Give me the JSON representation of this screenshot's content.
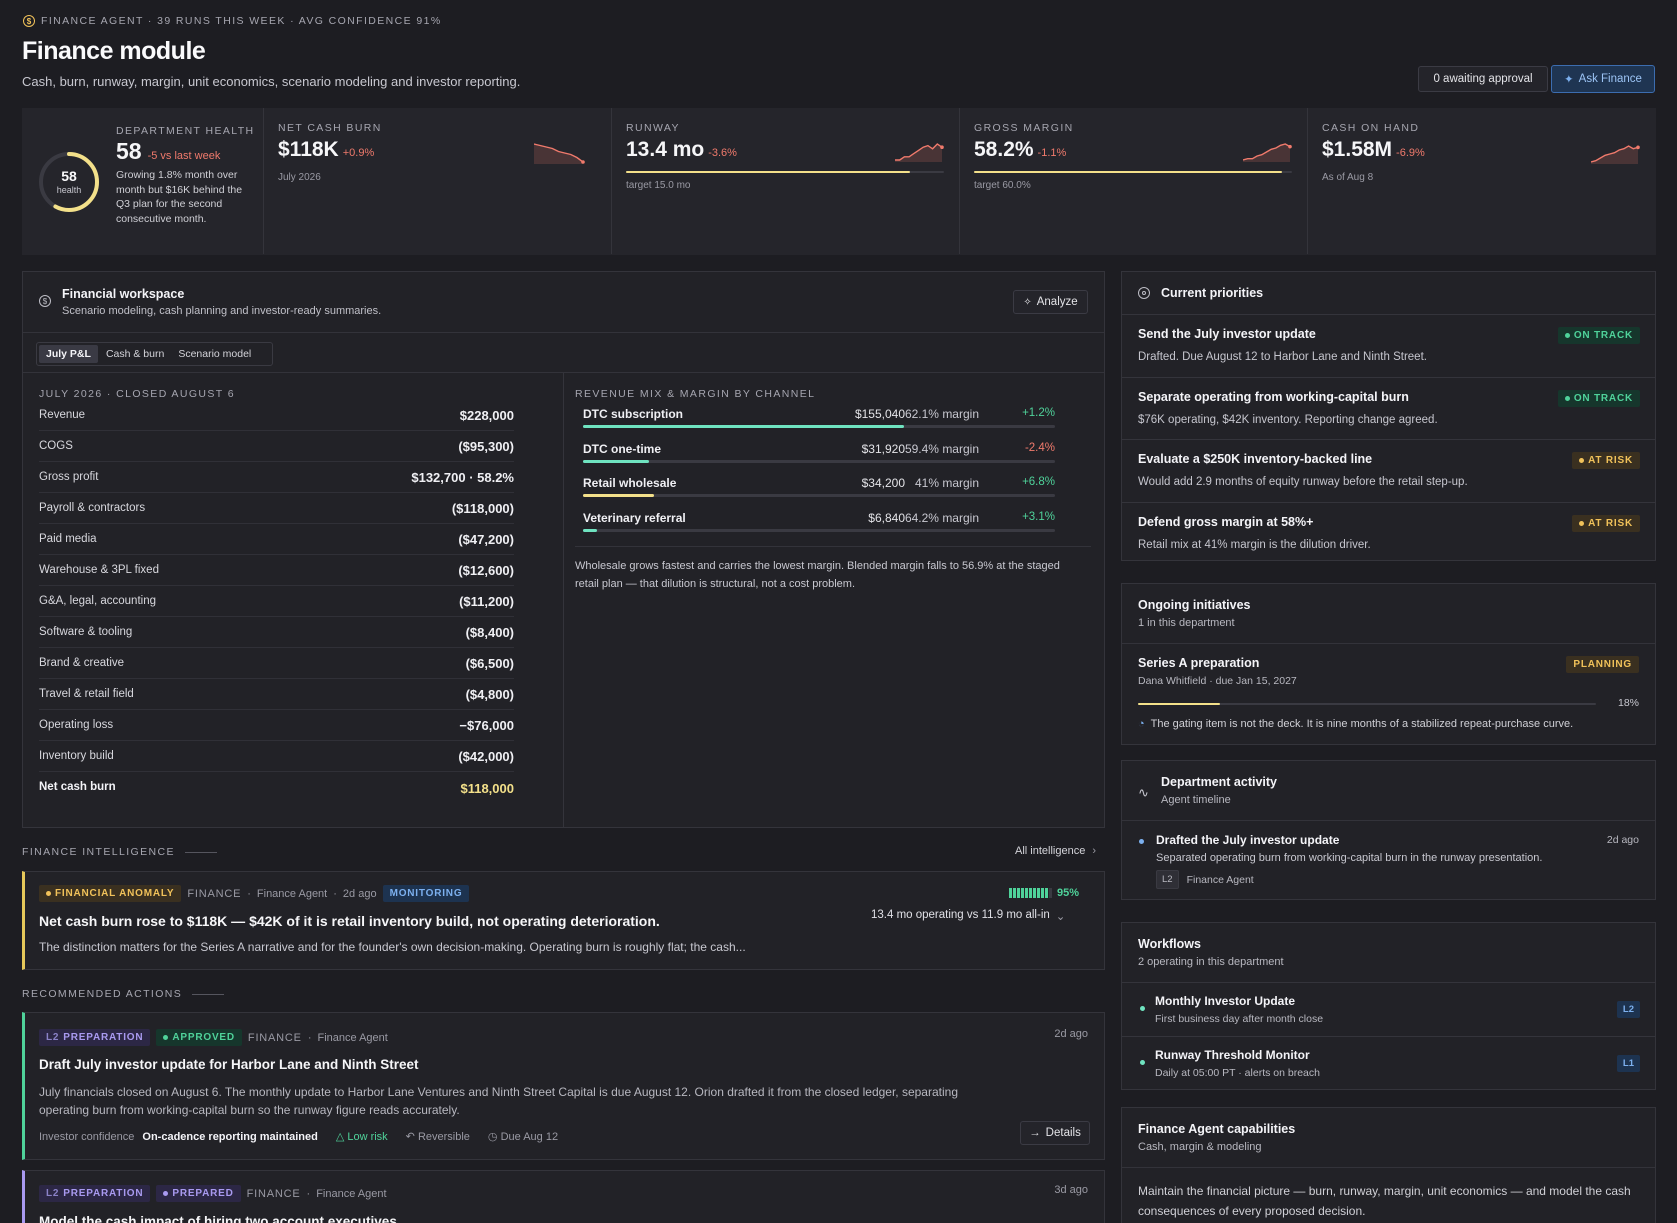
{
  "header": {
    "eyebrow": "FINANCE AGENT · 39 RUNS THIS WEEK · AVG CONFIDENCE 91%",
    "title": "Finance module",
    "subtitle": "Cash, burn, runway, margin, unit economics, scenario modeling and investor reporting.",
    "awaiting_label": "0 awaiting approval",
    "ask_label": "Ask Finance"
  },
  "health": {
    "score": "58",
    "score_caption": "health",
    "score_value": 0.58,
    "label": "DEPARTMENT HEALTH",
    "big": "58",
    "delta": "-5 vs last week",
    "desc": "Growing 1.8% month over month but $16K behind the Q3 plan for the second consecutive month."
  },
  "kpis": [
    {
      "label": "NET CASH BURN",
      "value": "$118K",
      "change": "+0.9%",
      "sub": "July 2026",
      "progress": null,
      "trend": [
        14,
        13,
        12,
        11,
        9,
        8,
        7,
        5,
        2
      ]
    },
    {
      "label": "RUNWAY",
      "value": "13.4 mo",
      "change": "-3.6%",
      "sub": "target 15.0 mo",
      "progress": 0.893,
      "trend": [
        4,
        4,
        6,
        6,
        8,
        10,
        12,
        13,
        11,
        14,
        12
      ]
    },
    {
      "label": "GROSS MARGIN",
      "value": "58.2%",
      "change": "-1.1%",
      "sub": "target 60.0%",
      "progress": 0.97,
      "trend": [
        2,
        3,
        3,
        5,
        6,
        8,
        10,
        11,
        13,
        14,
        12
      ]
    },
    {
      "label": "CASH ON HAND",
      "value": "$1.58M",
      "change": "-6.9%",
      "sub": "As of Aug 8",
      "progress": null,
      "trend": [
        2,
        3,
        5,
        7,
        8,
        9,
        11,
        12,
        14,
        12,
        13
      ]
    }
  ],
  "workspace": {
    "title": "Financial workspace",
    "subtitle": "Scenario modeling, cash planning and investor-ready summaries.",
    "analyze_label": "Analyze",
    "tabs": [
      "July P&L",
      "Cash & burn",
      "Scenario model"
    ],
    "pl_heading": "JULY 2026 · CLOSED AUGUST 6",
    "pl_rows": [
      {
        "label": "Revenue",
        "value": "$228,000"
      },
      {
        "label": "COGS",
        "value": "($95,300)"
      },
      {
        "label": "Gross profit",
        "value": "$132,700 · 58.2%"
      },
      {
        "label": "Payroll & contractors",
        "value": "($118,000)"
      },
      {
        "label": "Paid media",
        "value": "($47,200)"
      },
      {
        "label": "Warehouse & 3PL fixed",
        "value": "($12,600)"
      },
      {
        "label": "G&A, legal, accounting",
        "value": "($11,200)"
      },
      {
        "label": "Software & tooling",
        "value": "($8,400)"
      },
      {
        "label": "Brand & creative",
        "value": "($6,500)"
      },
      {
        "label": "Travel & retail field",
        "value": "($4,800)"
      },
      {
        "label": "Operating loss",
        "value": "−$76,000"
      },
      {
        "label": "Inventory build",
        "value": "($42,000)"
      }
    ],
    "net_label": "Net cash burn",
    "net_value": "$118,000",
    "mix_heading": "REVENUE MIX & MARGIN BY CHANNEL",
    "channels": [
      {
        "name": "DTC subscription",
        "amount": "$155,040",
        "margin": "62.1% margin",
        "delta": "+1.2%",
        "share": 0.68,
        "color": "#6fe3c0",
        "delta_color": "#4fd29a"
      },
      {
        "name": "DTC one-time",
        "amount": "$31,920",
        "margin": "59.4% margin",
        "delta": "-2.4%",
        "share": 0.14,
        "color": "#6fe3c0",
        "delta_color": "#f07a6c"
      },
      {
        "name": "Retail wholesale",
        "amount": "$34,200",
        "margin": "41% margin",
        "delta": "+6.8%",
        "share": 0.15,
        "color": "#f3e08a",
        "delta_color": "#4fd29a"
      },
      {
        "name": "Veterinary referral",
        "amount": "$6,840",
        "margin": "64.2% margin",
        "delta": "+3.1%",
        "share": 0.03,
        "color": "#6fe3c0",
        "delta_color": "#4fd29a"
      }
    ],
    "mix_note": "Wholesale grows fastest and carries the lowest margin. Blended margin falls to 56.9% at the staged retail plan — that dilution is structural, not a cost problem."
  },
  "intelligence": {
    "heading": "FINANCE INTELLIGENCE",
    "all_label": "All intelligence",
    "tag": "FINANCIAL ANOMALY",
    "dept": "FINANCE",
    "agent": "Finance Agent",
    "time": "2d ago",
    "status": "MONITORING",
    "confidence": "95%",
    "confidence_value": 0.95,
    "title": "Net cash burn rose to $118K — $42K of it is retail inventory build, not operating deterioration.",
    "summary": "13.4 mo operating vs 11.9 mo all-in",
    "body": "The distinction matters for the Series A narrative and for the founder's own decision-making. Operating burn is roughly flat; the cash..."
  },
  "actions": {
    "heading": "RECOMMENDED ACTIONS",
    "items": [
      {
        "level": "L2",
        "kind": "PREPARATION",
        "status": "APPROVED",
        "dept": "FINANCE",
        "agent": "Finance Agent",
        "time": "2d ago",
        "title": "Draft July investor update for Harbor Lane and Ninth Street",
        "body": "July financials closed on August 6. The monthly update to Harbor Lane Ventures and Ninth Street Capital is due August 12. Orion drafted it from the closed ledger, separating operating burn from working-capital burn so the runway figure reads accurately.",
        "impact_label": "Investor confidence",
        "impact_value": "On-cadence reporting maintained",
        "risk": "Low risk",
        "reversible": "Reversible",
        "due": "Due Aug 12",
        "details_label": "Details"
      },
      {
        "level": "L2",
        "kind": "PREPARATION",
        "status": "PREPARED",
        "dept": "FINANCE",
        "agent": "Finance Agent",
        "time": "3d ago",
        "title": "Model the cash impact of hiring two account executives"
      }
    ]
  },
  "priorities": {
    "title": "Current priorities",
    "items": [
      {
        "title": "Send the July investor update",
        "desc": "Drafted. Due August 12 to Harbor Lane and Ninth Street.",
        "status": "ON TRACK"
      },
      {
        "title": "Separate operating from working-capital burn",
        "desc": "$76K operating, $42K inventory. Reporting change agreed.",
        "status": "ON TRACK"
      },
      {
        "title": "Evaluate a $250K inventory-backed line",
        "desc": "Would add 2.9 months of equity runway before the retail step-up.",
        "status": "AT RISK"
      },
      {
        "title": "Defend gross margin at 58%+",
        "desc": "Retail mix at 41% margin is the dilution driver.",
        "status": "AT RISK"
      }
    ]
  },
  "initiatives": {
    "title": "Ongoing initiatives",
    "count": "1 in this department",
    "name": "Series A preparation",
    "meta": "Dana Whitfield · due Jan 15, 2027",
    "status": "PLANNING",
    "progress": "18%",
    "progress_value": 0.18,
    "note": "The gating item is not the deck. It is nine months of a stabilized repeat-purchase curve."
  },
  "activity": {
    "title": "Department activity",
    "subtitle": "Agent timeline",
    "item_title": "Drafted the July investor update",
    "item_time": "2d ago",
    "item_desc": "Separated operating burn from working-capital burn in the runway presentation.",
    "item_level": "L2",
    "item_agent": "Finance Agent"
  },
  "workflows": {
    "title": "Workflows",
    "count": "2 operating in this department",
    "items": [
      {
        "name": "Monthly Investor Update",
        "schedule": "First business day after month close",
        "level": "L2"
      },
      {
        "name": "Runway Threshold Monitor",
        "schedule": "Daily at 05:00 PT · alerts on breach",
        "level": "L1"
      }
    ]
  },
  "capabilities": {
    "title": "Finance Agent capabilities",
    "subtitle": "Cash, margin & modeling",
    "desc": "Maintain the financial picture — burn, runway, margin, unit economics — and model the cash consequences of every proposed decision."
  }
}
